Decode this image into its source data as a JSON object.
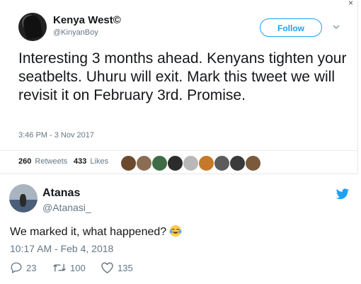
{
  "quoted_tweet": {
    "author_name": "Kenya West©",
    "author_handle": "@KinyanBoy",
    "follow_label": "Follow",
    "text": "Interesting 3 months ahead. Kenyans tighten your seatbelts. Uhuru will exit. Mark this tweet we will revisit it on February 3rd. Promise.",
    "timestamp": "3:46 PM - 3 Nov 2017",
    "retweets_count": "260",
    "retweets_label": "Retweets",
    "likes_count": "433",
    "likes_label": "Likes",
    "liker_colors": [
      "#6b4a2e",
      "#8a6d52",
      "#3f6b47",
      "#2c2c2c",
      "#b8b8b8",
      "#c47a2a",
      "#5c5c5c",
      "#3a3a3a",
      "#7a5a3a"
    ]
  },
  "reply_tweet": {
    "author_name": "Atanas",
    "author_handle": "@Atanasi_",
    "text": "We marked it, what happened?",
    "emoji": "face-with-tears-of-joy",
    "timestamp": "10:17 AM - Feb 4, 2018",
    "reply_count": "23",
    "retweet_count": "100",
    "like_count": "135"
  },
  "colors": {
    "twitter_blue": "#1da1f2",
    "text_primary": "#14171a",
    "text_secondary": "#657786"
  },
  "corner_glyph": "×"
}
